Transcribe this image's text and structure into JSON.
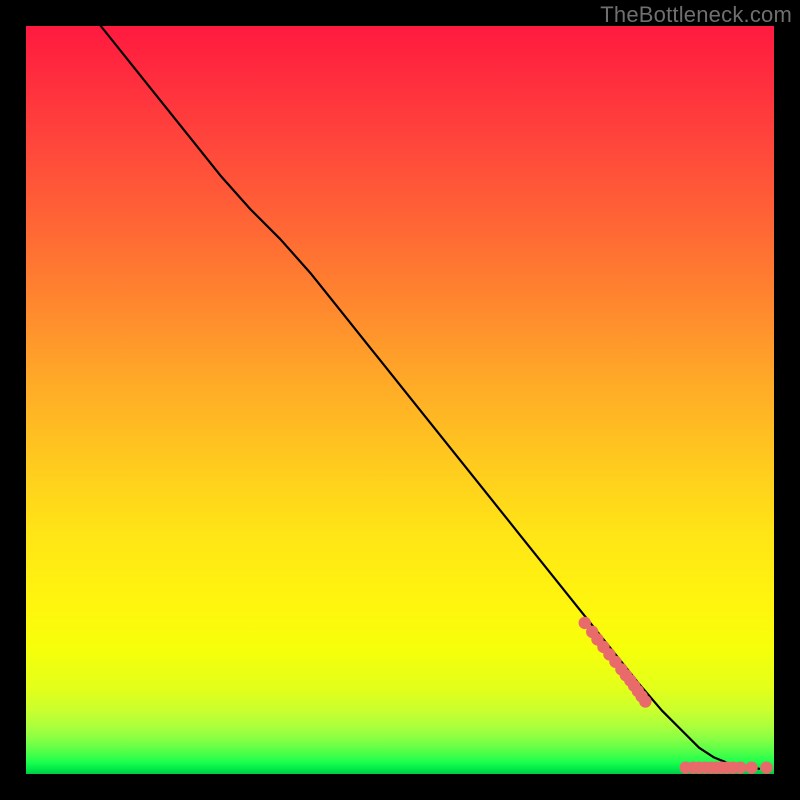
{
  "watermark": "TheBottleneck.com",
  "colors": {
    "frame": "#000000",
    "line": "#000000",
    "marker": "#e86a6a",
    "watermark": "#6f6f6f",
    "gradient_top": "#ff1a3f",
    "gradient_bottom": "#00c845"
  },
  "chart_data": {
    "type": "line",
    "title": "",
    "xlabel": "",
    "ylabel": "",
    "xlim": [
      0,
      100
    ],
    "ylim": [
      0,
      100
    ],
    "grid": false,
    "legend": null,
    "series": [
      {
        "name": "curve",
        "style": "line",
        "color": "#000000",
        "x": [
          10,
          14,
          18,
          22,
          26,
          30,
          34,
          38,
          42,
          46,
          50,
          54,
          58,
          62,
          66,
          70,
          74,
          78,
          82,
          85,
          88,
          90,
          92,
          94,
          96,
          98
        ],
        "y": [
          100,
          95,
          90,
          85,
          80,
          75.5,
          71.5,
          67,
          62,
          57,
          52,
          47,
          42,
          37,
          32,
          27,
          22,
          17,
          12,
          8.5,
          5.5,
          3.5,
          2.2,
          1.4,
          0.9,
          0.7
        ]
      },
      {
        "name": "markers-diagonal",
        "style": "scatter",
        "color": "#e86a6a",
        "x": [
          74.7,
          75.7,
          76.4,
          77.2,
          78.0,
          78.8,
          79.6,
          80.2,
          80.8,
          81.3,
          81.8,
          82.3,
          82.8
        ],
        "y": [
          20.2,
          19.0,
          18.0,
          17.0,
          16.0,
          15.0,
          14.0,
          13.2,
          12.5,
          11.8,
          11.1,
          10.4,
          9.7
        ]
      },
      {
        "name": "markers-bottom",
        "style": "scatter",
        "color": "#e86a6a",
        "x": [
          88.2,
          89.2,
          90.0,
          90.8,
          91.6,
          92.3,
          93.0,
          93.7,
          94.5,
          95.5,
          97.0,
          99.0
        ],
        "y": [
          0.85,
          0.85,
          0.85,
          0.85,
          0.85,
          0.85,
          0.85,
          0.85,
          0.85,
          0.85,
          0.85,
          0.85
        ]
      }
    ]
  }
}
